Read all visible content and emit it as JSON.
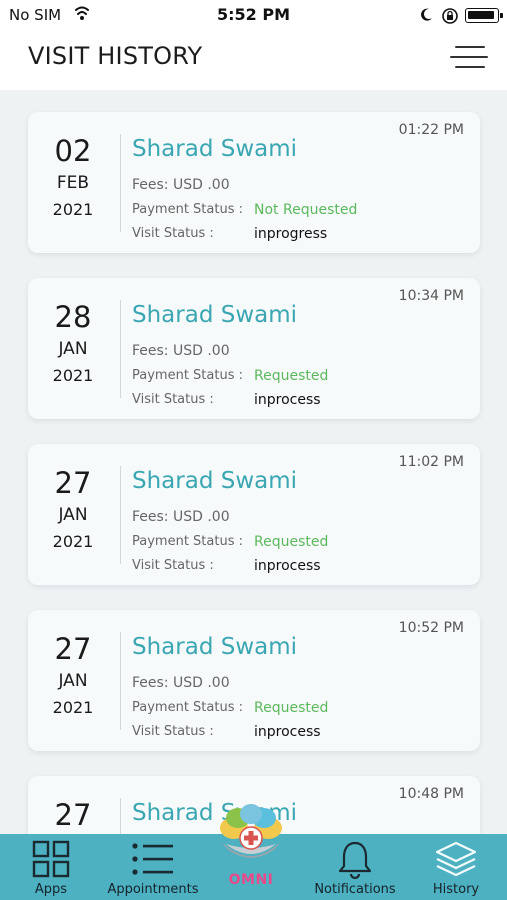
{
  "status_bar": {
    "carrier": "No SIM",
    "time": "5:52 PM"
  },
  "header": {
    "title": "VISIT HISTORY"
  },
  "visits": [
    {
      "day": "02",
      "month": "FEB",
      "year": "2021",
      "name": "Sharad Swami",
      "time": "01:22 PM",
      "fees": "Fees: USD .00",
      "payment_label": "Payment Status :",
      "payment_value": "Not Requested",
      "visit_label": "Visit Status :",
      "visit_value": "inprogress"
    },
    {
      "day": "28",
      "month": "JAN",
      "year": "2021",
      "name": "Sharad Swami",
      "time": "10:34 PM",
      "fees": "Fees: USD .00",
      "payment_label": "Payment Status :",
      "payment_value": "Requested",
      "visit_label": "Visit Status :",
      "visit_value": "inprocess"
    },
    {
      "day": "27",
      "month": "JAN",
      "year": "2021",
      "name": "Sharad Swami",
      "time": "11:02 PM",
      "fees": "Fees: USD .00",
      "payment_label": "Payment Status :",
      "payment_value": "Requested",
      "visit_label": "Visit Status :",
      "visit_value": "inprocess"
    },
    {
      "day": "27",
      "month": "JAN",
      "year": "2021",
      "name": "Sharad Swami",
      "time": "10:52 PM",
      "fees": "Fees: USD .00",
      "payment_label": "Payment Status :",
      "payment_value": "Requested",
      "visit_label": "Visit Status :",
      "visit_value": "inprocess"
    },
    {
      "day": "27",
      "month": "",
      "year": "",
      "name": "Sharad Swami",
      "time": "10:48 PM",
      "fees": "",
      "payment_label": "",
      "payment_value": "",
      "visit_label": "",
      "visit_value": ""
    }
  ],
  "tabs": [
    {
      "label": "Apps",
      "icon": "grid-icon"
    },
    {
      "label": "Appointments",
      "icon": "list-icon"
    },
    {
      "label": "Notifications",
      "icon": "bell-icon"
    },
    {
      "label": "History",
      "icon": "layers-icon"
    }
  ],
  "center_logo": {
    "text": "OMNI"
  },
  "colors": {
    "accent": "#3aa6b2",
    "tabbar": "#4db1c1",
    "status_green": "#5cb85c",
    "background": "#eef2f3"
  }
}
